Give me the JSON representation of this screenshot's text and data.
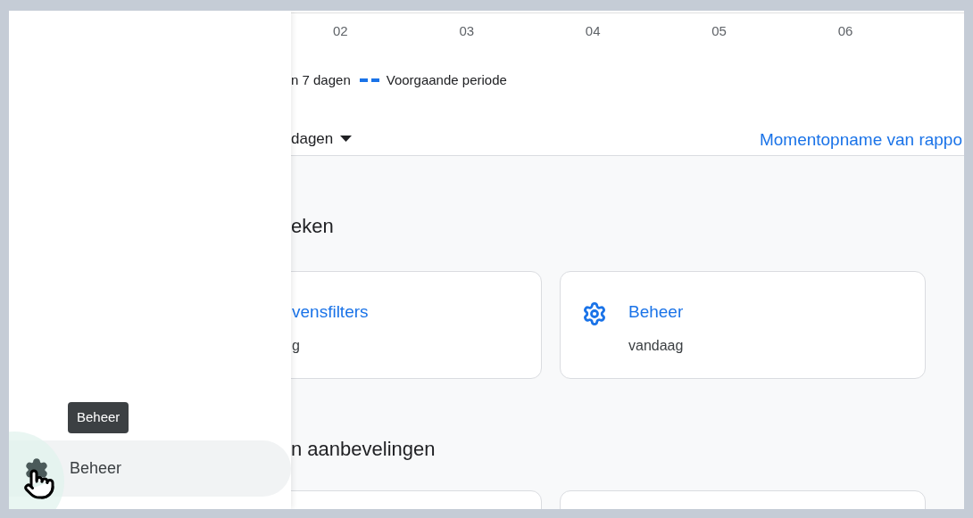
{
  "chart": {
    "x_ticks": [
      "02",
      "03",
      "04",
      "05",
      "06"
    ],
    "legend": [
      {
        "label": "n 7 dagen",
        "kind": "none"
      },
      {
        "label": "Voorgaande periode",
        "kind": "dashed",
        "color": "#1a73e8"
      }
    ]
  },
  "date_dropdown": {
    "label": "dagen"
  },
  "snapshot_link": "Momentopname van rappo",
  "recent_section": {
    "title": "eken",
    "cards": [
      {
        "title": "vensfilters",
        "subtitle": "g"
      },
      {
        "title": "Beheer",
        "subtitle": "vandaag"
      }
    ]
  },
  "insights_section": {
    "title": "n aanbevelingen"
  },
  "sidebar": {
    "tooltip": "Beheer",
    "items": [
      {
        "label": "Beheer",
        "selected": true
      }
    ]
  }
}
